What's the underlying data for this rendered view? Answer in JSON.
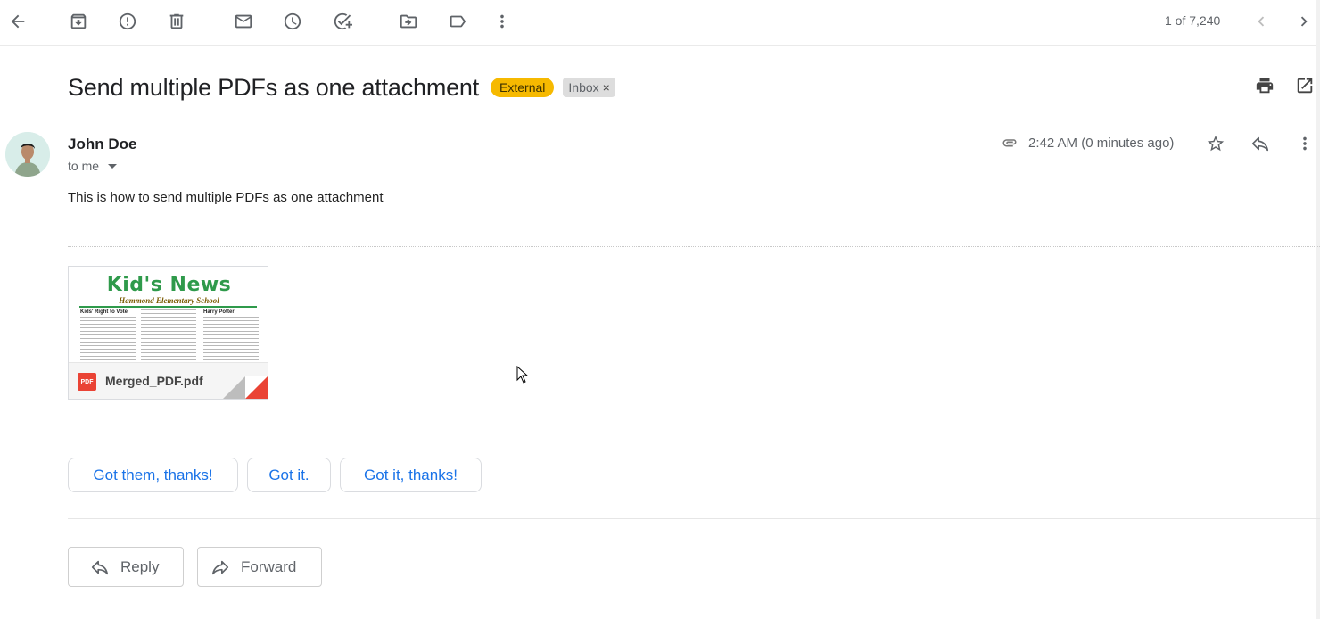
{
  "toolbar": {
    "pager": "1 of 7,240",
    "icons": [
      "back-arrow-icon",
      "archive-icon",
      "report-spam-icon",
      "delete-icon",
      "mark-unread-icon",
      "snooze-icon",
      "add-to-tasks-icon",
      "move-to-icon",
      "labels-icon",
      "more-vert-icon",
      "newer-icon",
      "older-icon"
    ]
  },
  "email": {
    "subject": "Send multiple PDFs as one attachment",
    "labels": {
      "external": "External",
      "inbox": "Inbox",
      "inbox_remove": "×"
    },
    "sender": "John Doe",
    "recipient": "to me",
    "timestamp": "2:42 AM (0 minutes ago)",
    "body": "This is how to send multiple PDFs as one attachment"
  },
  "attachment": {
    "filename": "Merged_PDF.pdf",
    "type_badge": "PDF",
    "thumbnail": {
      "title": "Kid's News",
      "subtitle": "Hammond Elementary School",
      "col1_title": "Kids' Right to Vote",
      "col3_title": "Harry Potter"
    }
  },
  "smart_replies": [
    "Got them, thanks!",
    "Got it.",
    "Got it, thanks!"
  ],
  "actions": {
    "reply": "Reply",
    "forward": "Forward"
  },
  "colors": {
    "external_chip": "#f6b900",
    "inbox_chip": "#dddddd",
    "link_blue": "#1a73e8",
    "pdf_red": "#ea4335"
  }
}
